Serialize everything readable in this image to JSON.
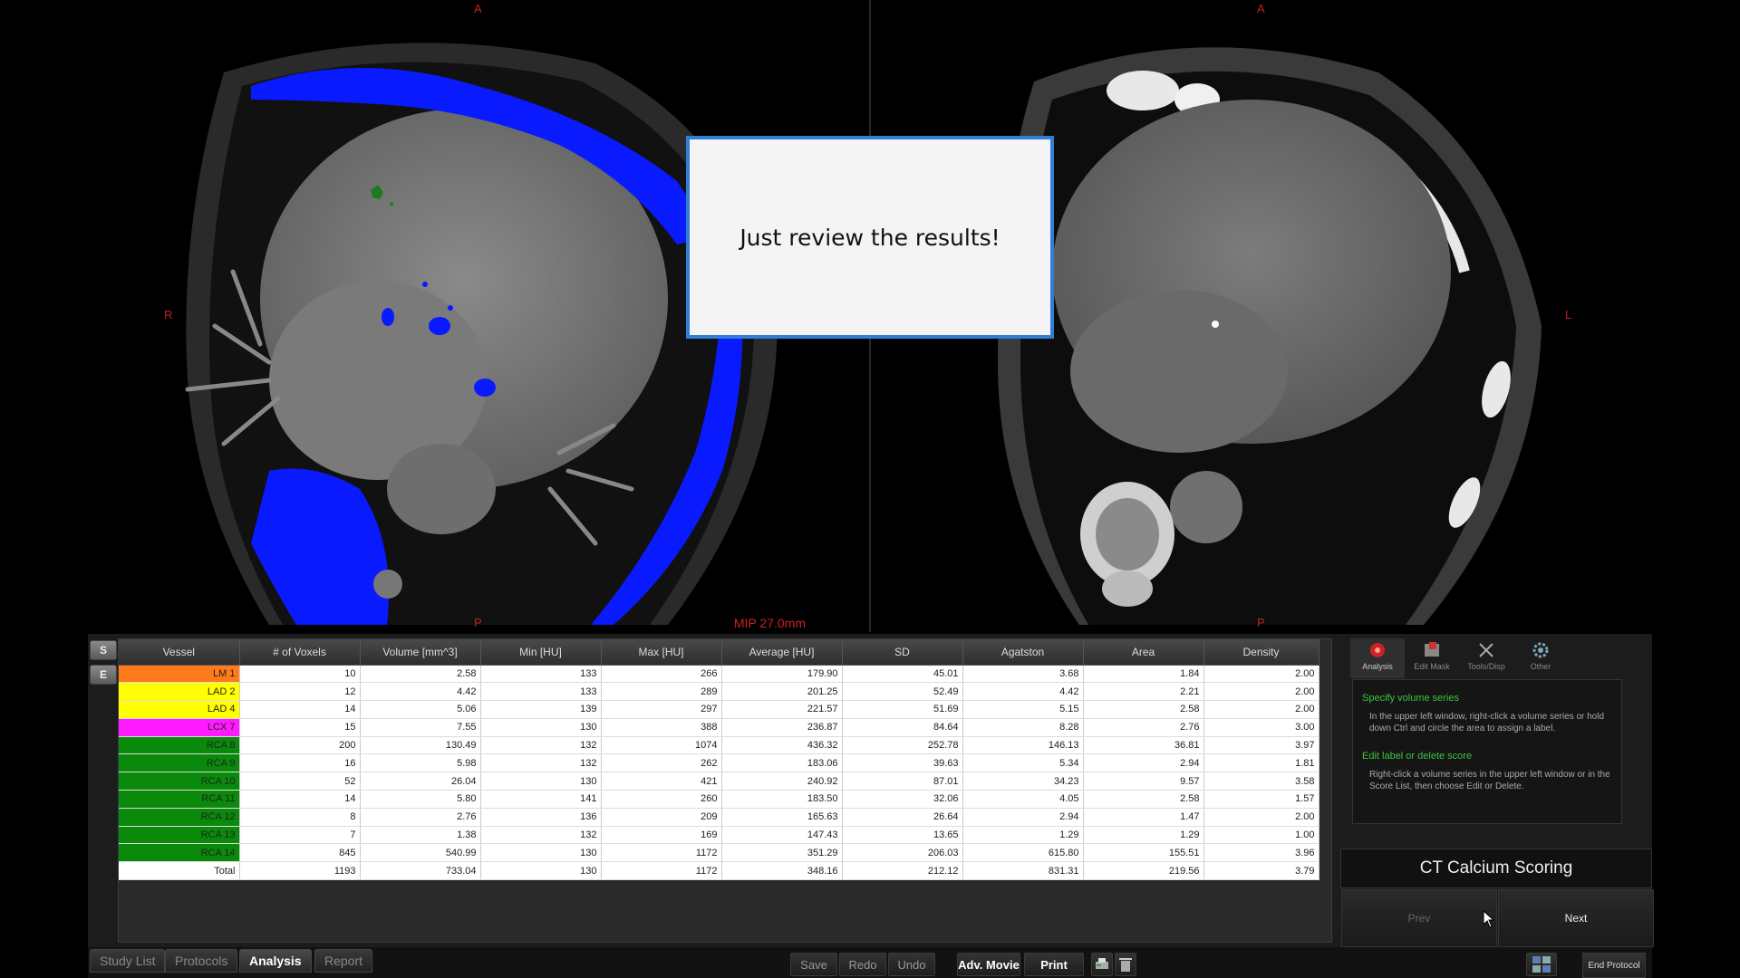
{
  "viewports": {
    "left": {
      "orient_top": "A",
      "orient_left": "R",
      "orient_bottom": "P",
      "mip": "MIP 27.0mm"
    },
    "right": {
      "orient_top": "A",
      "orient_right": "L",
      "orient_bottom": "P"
    }
  },
  "dialog": {
    "message": "Just review the results!"
  },
  "side_buttons": {
    "s": "S",
    "e": "E"
  },
  "table": {
    "columns": [
      "Vessel",
      "# of Voxels",
      "Volume [mm^3]",
      "Min [HU]",
      "Max [HU]",
      "Average [HU]",
      "SD",
      "Agatston",
      "Area",
      "Density"
    ],
    "rows": [
      {
        "vessel": "LM 1",
        "color": "#ff7a1a",
        "voxels": "10",
        "volume": "2.58",
        "min": "133",
        "max": "266",
        "avg": "179.90",
        "sd": "45.01",
        "agatston": "3.68",
        "area": "1.84",
        "density": "2.00"
      },
      {
        "vessel": "LAD 2",
        "color": "#ffff00",
        "voxels": "12",
        "volume": "4.42",
        "min": "133",
        "max": "289",
        "avg": "201.25",
        "sd": "52.49",
        "agatston": "4.42",
        "area": "2.21",
        "density": "2.00"
      },
      {
        "vessel": "LAD 4",
        "color": "#ffff00",
        "voxels": "14",
        "volume": "5.06",
        "min": "139",
        "max": "297",
        "avg": "221.57",
        "sd": "51.69",
        "agatston": "5.15",
        "area": "2.58",
        "density": "2.00"
      },
      {
        "vessel": "LCX 7",
        "color": "#ff1aff",
        "voxels": "15",
        "volume": "7.55",
        "min": "130",
        "max": "388",
        "avg": "236.87",
        "sd": "84.64",
        "agatston": "8.28",
        "area": "2.76",
        "density": "3.00"
      },
      {
        "vessel": "RCA 8",
        "color": "#0a8a0a",
        "voxels": "200",
        "volume": "130.49",
        "min": "132",
        "max": "1074",
        "avg": "436.32",
        "sd": "252.78",
        "agatston": "146.13",
        "area": "36.81",
        "density": "3.97"
      },
      {
        "vessel": "RCA 9",
        "color": "#0a8a0a",
        "voxels": "16",
        "volume": "5.98",
        "min": "132",
        "max": "262",
        "avg": "183.06",
        "sd": "39.63",
        "agatston": "5.34",
        "area": "2.94",
        "density": "1.81"
      },
      {
        "vessel": "RCA 10",
        "color": "#0a8a0a",
        "voxels": "52",
        "volume": "26.04",
        "min": "130",
        "max": "421",
        "avg": "240.92",
        "sd": "87.01",
        "agatston": "34.23",
        "area": "9.57",
        "density": "3.58"
      },
      {
        "vessel": "RCA 11",
        "color": "#0a8a0a",
        "voxels": "14",
        "volume": "5.80",
        "min": "141",
        "max": "260",
        "avg": "183.50",
        "sd": "32.06",
        "agatston": "4.05",
        "area": "2.58",
        "density": "1.57"
      },
      {
        "vessel": "RCA 12",
        "color": "#0a8a0a",
        "voxels": "8",
        "volume": "2.76",
        "min": "136",
        "max": "209",
        "avg": "165.63",
        "sd": "26.64",
        "agatston": "2.94",
        "area": "1.47",
        "density": "2.00"
      },
      {
        "vessel": "RCA 13",
        "color": "#0a8a0a",
        "voxels": "7",
        "volume": "1.38",
        "min": "132",
        "max": "169",
        "avg": "147.43",
        "sd": "13.65",
        "agatston": "1.29",
        "area": "1.29",
        "density": "1.00"
      },
      {
        "vessel": "RCA 14",
        "color": "#0a8a0a",
        "voxels": "845",
        "volume": "540.99",
        "min": "130",
        "max": "1172",
        "avg": "351.29",
        "sd": "206.03",
        "agatston": "615.80",
        "area": "155.51",
        "density": "3.96"
      },
      {
        "vessel": "Total",
        "color": "#ffffff",
        "voxels": "1193",
        "volume": "733.04",
        "min": "130",
        "max": "1172",
        "avg": "348.16",
        "sd": "212.12",
        "agatston": "831.31",
        "area": "219.56",
        "density": "3.79"
      }
    ]
  },
  "tools": [
    {
      "label": "Analysis",
      "icon": "analysis-icon"
    },
    {
      "label": "Edit Mask",
      "icon": "edit-mask-icon"
    },
    {
      "label": "Tools/Disp",
      "icon": "tools-icon"
    },
    {
      "label": "Other",
      "icon": "gear-icon"
    }
  ],
  "help": {
    "title1": "Specify volume series",
    "text1": "In the upper left window, right-click a volume series or hold down Ctrl and circle the area to assign a label.",
    "title2": "Edit label or delete score",
    "text2": "Right-click a volume series in the upper left window or in the Score List, then choose Edit or Delete."
  },
  "protocol": {
    "title": "CT Calcium Scoring",
    "prev": "Prev",
    "next": "Next"
  },
  "footer": {
    "tabs": [
      "Study List",
      "Protocols",
      "Analysis",
      "Report"
    ],
    "active_tab": "Analysis",
    "save": "Save",
    "redo": "Redo",
    "undo": "Undo",
    "adv_movie": "Adv. Movie",
    "print": "Print",
    "end_protocol": "End Protocol"
  },
  "colors": {
    "calcium_blue": "#0a1aff",
    "dialog_border": "#2f7fd6",
    "help_green": "#3ec43e"
  }
}
